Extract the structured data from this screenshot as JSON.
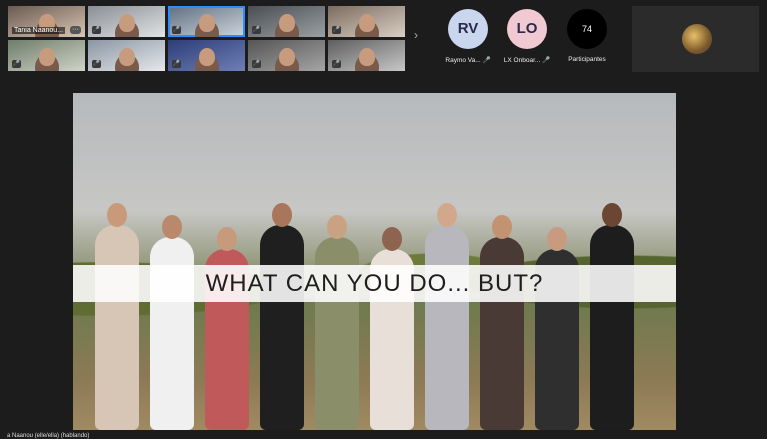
{
  "gallery": {
    "tiles": [
      {
        "name": "Tania Naanou...",
        "more": "···",
        "c1": "#6a5a50",
        "c2": "#d8c6b4"
      },
      {
        "mute": "🎤",
        "c1": "#8a8f95",
        "c2": "#e1e3e5"
      },
      {
        "mute": "🎤",
        "c1": "#5f6f80",
        "c2": "#cfd6dd",
        "active": true
      },
      {
        "mute": "🎤",
        "c1": "#4a4e52",
        "c2": "#9aa0a4"
      },
      {
        "mute": "🎤",
        "c1": "#7d6c60",
        "c2": "#d9cfc4"
      },
      {
        "mute": "🎤",
        "c1": "#6f7d6a",
        "c2": "#cfd4c8"
      },
      {
        "mute": "🎤",
        "c1": "#8b96a3",
        "c2": "#e5e8ec"
      },
      {
        "mute": "🎤",
        "c1": "#2c3d78",
        "c2": "#6f7fb5"
      },
      {
        "mute": "🎤",
        "c1": "#555",
        "c2": "#a5a5a5"
      },
      {
        "mute": "🎤",
        "c1": "#5e5e5e",
        "c2": "#c8c8c8"
      }
    ]
  },
  "participants_nav": {
    "chevron": "›"
  },
  "avatars": [
    {
      "initials": "RV",
      "label": "Raymo Va...",
      "mute": "🎤",
      "color": "#c9d6ee"
    },
    {
      "initials": "LO",
      "label": "LX Onboar...",
      "mute": "🎤",
      "color": "#f1c9d3"
    }
  ],
  "participants": {
    "count": "74",
    "label": "Participantes"
  },
  "slide": {
    "banner_text": "WHAT CAN YOU DO... BUT?",
    "speaker": "a Naanou (elle/ella) (hablando)"
  }
}
